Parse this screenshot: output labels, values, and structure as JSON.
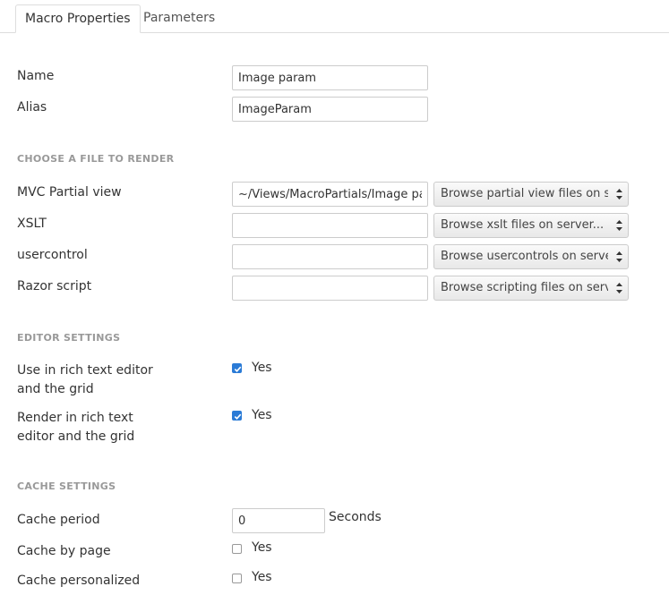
{
  "tabs": [
    {
      "label": "Macro Properties",
      "active": true
    },
    {
      "label": "Parameters",
      "active": false
    }
  ],
  "fields": {
    "name": {
      "label": "Name",
      "value": "Image param"
    },
    "alias": {
      "label": "Alias",
      "value": "ImageParam"
    }
  },
  "render_section": {
    "title": "CHOOSE A FILE TO RENDER",
    "rows": [
      {
        "label": "MVC Partial view",
        "value": "~/Views/MacroPartials/Image param.cshtml",
        "select": "Browse partial view files on server..."
      },
      {
        "label": "XSLT",
        "value": "",
        "select": "Browse xslt files on server..."
      },
      {
        "label": "usercontrol",
        "value": "",
        "select": "Browse usercontrols on server..."
      },
      {
        "label": "Razor script",
        "value": "",
        "select": "Browse scripting files on server..."
      }
    ]
  },
  "editor_section": {
    "title": "EDITOR SETTINGS",
    "use_in_editor": {
      "label_line1": "Use in rich text editor",
      "label_line2": "and the grid",
      "checked": true,
      "option": "Yes"
    },
    "render_in_editor": {
      "label_line1": "Render in rich text",
      "label_line2": "editor and the grid",
      "checked": true,
      "option": "Yes"
    }
  },
  "cache_section": {
    "title": "CACHE SETTINGS",
    "period": {
      "label": "Cache period",
      "value": "0",
      "unit": "Seconds"
    },
    "by_page": {
      "label": "Cache by page",
      "checked": false,
      "option": "Yes"
    },
    "personalized": {
      "label": "Cache personalized",
      "checked": false,
      "option": "Yes"
    }
  },
  "colors": {
    "accent": "#2b7bd6",
    "section": "#999999",
    "border": "#cccccc"
  }
}
